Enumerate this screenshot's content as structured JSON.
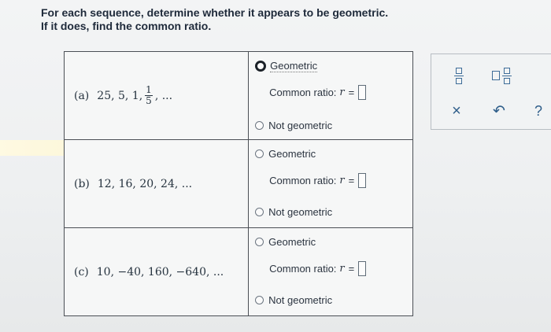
{
  "prompt": {
    "line1": "For each sequence, determine whether it appears to be geometric.",
    "line2": "If it does, find the common ratio."
  },
  "questions": [
    {
      "label": "(a)",
      "terms_before": "25, 5, 1,",
      "fraction": {
        "num": "1",
        "den": "5"
      },
      "terms_after": ", ...",
      "option_geometric": "Geometric",
      "common_ratio_label": "Common ratio:",
      "ratio_var": "r",
      "equals": "=",
      "option_not": "Not geometric",
      "selected": "geometric"
    },
    {
      "label": "(b)",
      "terms": "12, 16, 20, 24, ...",
      "option_geometric": "Geometric",
      "common_ratio_label": "Common ratio:",
      "ratio_var": "r",
      "equals": "=",
      "option_not": "Not geometric",
      "selected": "none"
    },
    {
      "label": "(c)",
      "terms": "10, −40, 160, −640, ...",
      "option_geometric": "Geometric",
      "common_ratio_label": "Common ratio:",
      "ratio_var": "r",
      "equals": "=",
      "option_not": "Not geometric",
      "selected": "none"
    }
  ],
  "toolbox": {
    "clear_symbol": "×",
    "undo_symbol": "↶",
    "help_symbol": "?",
    "icons": [
      "fraction-icon",
      "mixed-number-icon",
      "clear-icon",
      "undo-icon",
      "help-icon"
    ]
  },
  "colors": {
    "icon_blue": "#3d6c98",
    "border": "#4b4f55",
    "text": "#1e2a3a"
  }
}
